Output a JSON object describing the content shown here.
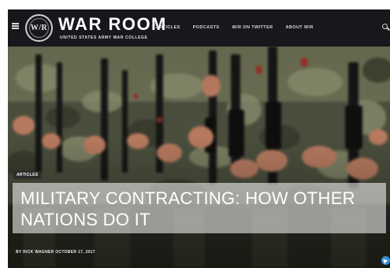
{
  "header": {
    "logo_text": "W/R",
    "title": "WAR ROOM",
    "subtitle": "UNITED STATES ARMY WAR COLLEGE",
    "nav": [
      "ARTICLES",
      "PODCASTS",
      "W/R ON TWITTER",
      "ABOUT W/R"
    ]
  },
  "hero": {
    "tag": "ARTICLES",
    "headline": "MILITARY CONTRACTING: HOW OTHER NATIONS DO IT",
    "byline": "BY RICK WAGNER OCTOBER 17, 2017"
  },
  "colors": {
    "header_bg": "#17181b",
    "camo_dark": "#3d4032",
    "camo_light": "#8c9070",
    "skin": "#b77a5f",
    "rifle": "#151515",
    "share_accent": "#3b8fd6"
  },
  "icons": [
    "menu-icon",
    "search-icon",
    "telegram-icon"
  ]
}
